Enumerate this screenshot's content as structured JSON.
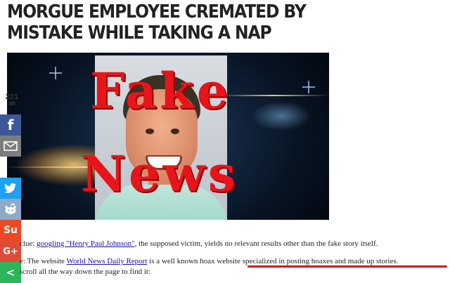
{
  "article": {
    "headline_line1": "MORGUE EMPLOYEE CREMATED BY",
    "headline_line2": "MISTAKE WHILE TAKING A NAP"
  },
  "image": {
    "stamp_word1": "Fake",
    "stamp_word2": "News",
    "stamp_color": "#e8141a"
  },
  "share": {
    "count": "221",
    "count_label": "sh",
    "facebook_icon": "f",
    "stumbleupon_icon": "Su",
    "googleplus_icon": "G+",
    "generic_share_icon": "<",
    "buttons": [
      "facebook",
      "email",
      "twitter",
      "reddit",
      "stumbleupon",
      "google-plus",
      "share"
    ]
  },
  "body": {
    "line1_prefix": "clue: ",
    "line1_link": "googling \"Henry Paul Johnson\"",
    "line1_suffix": ", the supposed victim, yields no relevant results other than the fake story itself.",
    "line2_prefix": "e: The website ",
    "line2_link": "World News Daily Report",
    "line2_suffix": " is a well known hoax website specialized in posting hoaxes and made up stories.",
    "line3": "scroll all the way down the page to find it:"
  },
  "highlight_color": "#d31a1a"
}
